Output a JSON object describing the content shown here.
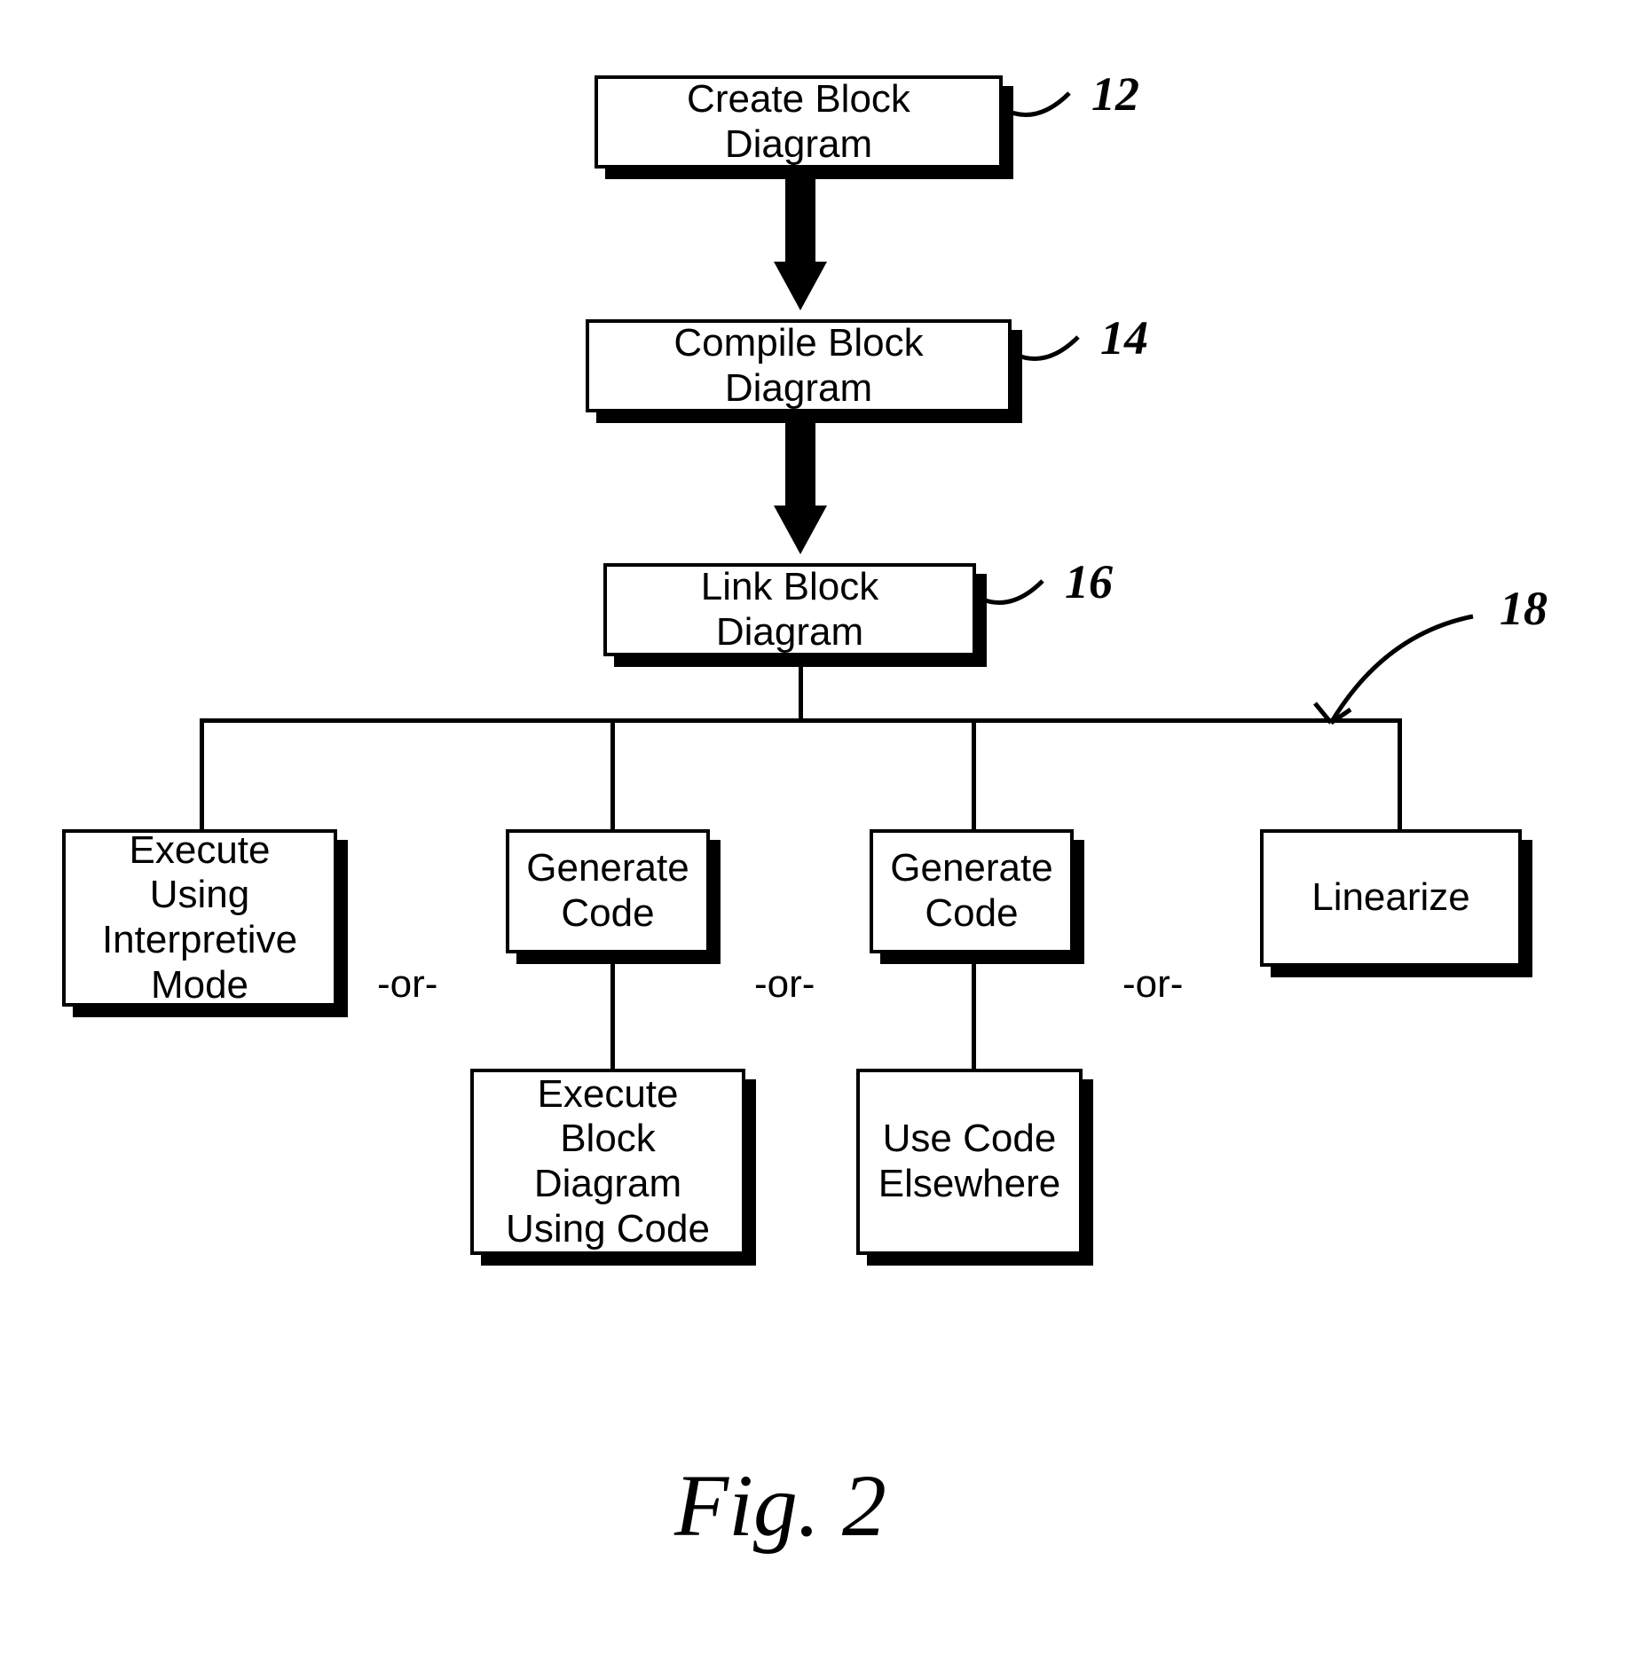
{
  "boxes": {
    "create": "Create Block Diagram",
    "compile": "Compile Block Diagram",
    "link": "Link Block Diagram",
    "exec_interp": "Execute Using Interpretive Mode",
    "gen_code_1": "Generate Code",
    "gen_code_2": "Generate Code",
    "linearize": "Linearize",
    "exec_block_code": "Execute Block Diagram Using Code",
    "use_code_else": "Use Code Elsewhere"
  },
  "refs": {
    "r12": "12",
    "r14": "14",
    "r16": "16",
    "r18": "18"
  },
  "or_label": "-or-",
  "caption": "Fig. 2"
}
